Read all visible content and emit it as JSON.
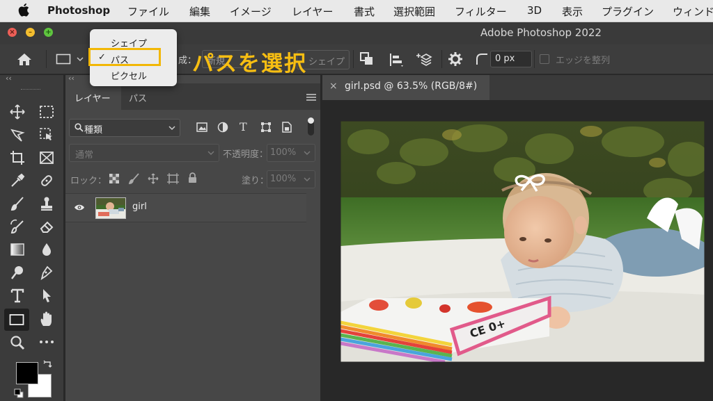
{
  "menubar": {
    "app_name": "Photoshop",
    "items": [
      "ファイル",
      "編集",
      "イメージ",
      "レイヤー",
      "書式",
      "選択範囲",
      "フィルター",
      "3D",
      "表示",
      "プラグイン",
      "ウィンドウ"
    ]
  },
  "window": {
    "title": "Adobe Photoshop 2022"
  },
  "options_bar": {
    "mode_label_partial": "成：",
    "mode_value_partial": "新規",
    "shape_button_partial": "シェイプ",
    "corner_radius": "0 px",
    "align_edges_label": "エッジを整列"
  },
  "tool_mode_menu": {
    "items": [
      "シェイプ",
      "パス",
      "ピクセル"
    ],
    "selected": "パス",
    "checkmark": "✓"
  },
  "annotation": {
    "text": "パスを選択",
    "color": "#f7be12"
  },
  "layers_panel": {
    "tabs": [
      "レイヤー",
      "パス"
    ],
    "filter_kind": "種類",
    "blend_mode": "通常",
    "opacity_label": "不透明度：",
    "opacity_value": "100%",
    "lock_label": "ロック：",
    "fill_label": "塗り：",
    "fill_value": "100%",
    "layers": [
      {
        "name": "girl",
        "visible": true
      }
    ]
  },
  "document": {
    "tab_title": "girl.psd @ 63.5% (RGB/8#)"
  },
  "colors": {
    "accent": "#f2b705",
    "foreground": "#000000",
    "background": "#ffffff"
  }
}
